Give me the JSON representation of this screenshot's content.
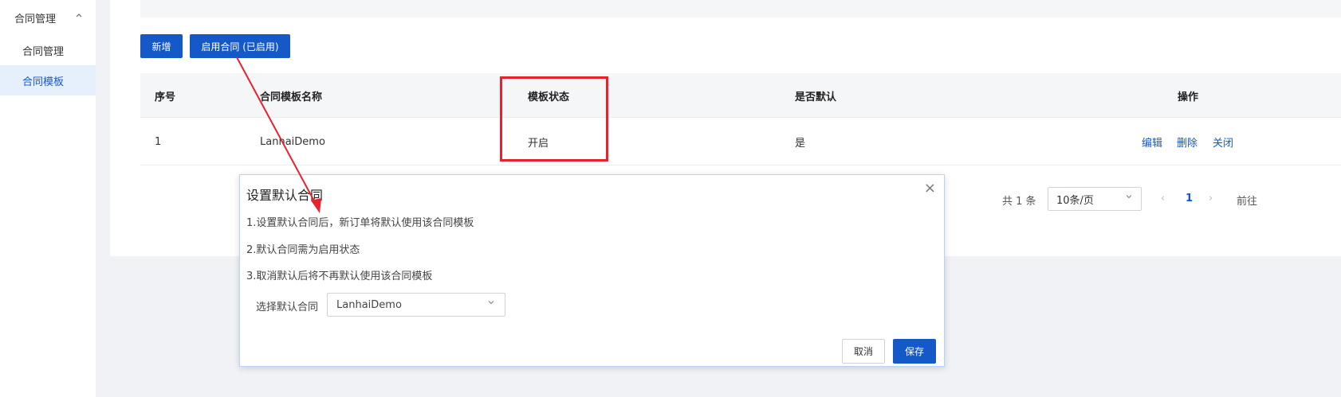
{
  "sidebar": {
    "group_label": "合同管理",
    "items": [
      {
        "label": "合同管理"
      },
      {
        "label": "合同模板"
      }
    ]
  },
  "toolbar": {
    "add_label": "新增",
    "enable_label": "启用合同 (已启用)"
  },
  "table": {
    "columns": [
      "序号",
      "合同模板名称",
      "模板状态",
      "是否默认",
      "操作"
    ],
    "rows": [
      {
        "index": "1",
        "name": "LanhaiDemo",
        "status": "开启",
        "is_default": "是"
      }
    ],
    "actions": [
      "编辑",
      "删除",
      "关闭"
    ]
  },
  "pagination": {
    "total": "共 1 条",
    "page_size": "10条/页",
    "prev": "‹",
    "current": "1",
    "next": "›",
    "goto": "前往"
  },
  "modal": {
    "title": "设置默认合同",
    "close": "×",
    "lines": [
      "1.设置默认合同后，新订单将默认使用该合同模板",
      "2.默认合同需为启用状态",
      "3.取消默认后将不再默认使用该合同模板"
    ],
    "select_label": "选择默认合同",
    "select_value": "LanhaiDemo",
    "cancel_label": "取消",
    "save_label": "保存"
  },
  "colors": {
    "primary": "#1559c9",
    "annotation": "#e8222c",
    "active_bg": "#e6f0fd"
  }
}
